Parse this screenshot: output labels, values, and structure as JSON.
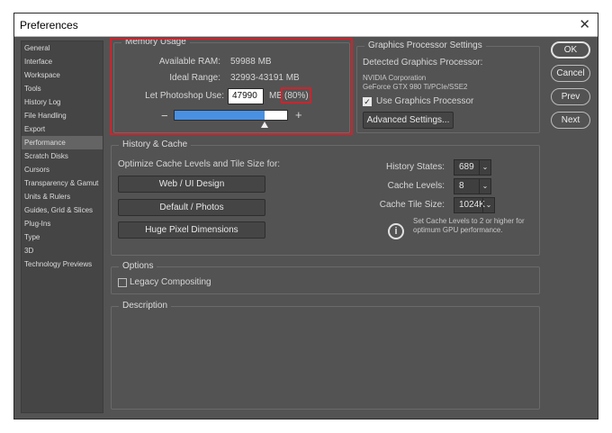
{
  "window": {
    "title": "Preferences",
    "close_glyph": "✕"
  },
  "sidebar": {
    "items": [
      {
        "label": "General"
      },
      {
        "label": "Interface"
      },
      {
        "label": "Workspace"
      },
      {
        "label": "Tools"
      },
      {
        "label": "History Log"
      },
      {
        "label": "File Handling"
      },
      {
        "label": "Export"
      },
      {
        "label": "Performance",
        "selected": true
      },
      {
        "label": "Scratch Disks"
      },
      {
        "label": "Cursors"
      },
      {
        "label": "Transparency & Gamut"
      },
      {
        "label": "Units & Rulers"
      },
      {
        "label": "Guides, Grid & Slices"
      },
      {
        "label": "Plug-Ins"
      },
      {
        "label": "Type"
      },
      {
        "label": "3D"
      },
      {
        "label": "Technology Previews"
      }
    ]
  },
  "memory": {
    "legend": "Memory Usage",
    "available_label": "Available RAM:",
    "available_value": "59988 MB",
    "ideal_label": "Ideal Range:",
    "ideal_value": "32993-43191 MB",
    "use_label": "Let Photoshop Use:",
    "use_value": "47990",
    "use_unit": "MB",
    "use_percent": "(80%)",
    "minus": "−",
    "plus": "+",
    "slider_fraction": 0.8,
    "highlight_color": "#d1222b"
  },
  "gpu": {
    "legend": "Graphics Processor Settings",
    "detected_label": "Detected Graphics Processor:",
    "vendor": "NVIDIA Corporation",
    "model": "GeForce GTX 980 Ti/PCIe/SSE2",
    "use_gpu_label": "Use Graphics Processor",
    "use_gpu_checked": true,
    "advanced_button": "Advanced Settings..."
  },
  "history_cache": {
    "legend": "History & Cache",
    "optimize_label": "Optimize Cache Levels and Tile Size for:",
    "buttons": [
      "Web / UI Design",
      "Default / Photos",
      "Huge Pixel Dimensions"
    ],
    "history_states_label": "History States:",
    "history_states_value": "689",
    "cache_levels_label": "Cache Levels:",
    "cache_levels_value": "8",
    "cache_tile_label": "Cache Tile Size:",
    "cache_tile_value": "1024K",
    "info_text_1": "Set Cache Levels to 2 or higher for",
    "info_text_2": "optimum GPU performance.",
    "info_icon": "i",
    "caret": "⌄"
  },
  "options": {
    "legend": "Options",
    "legacy_label": "Legacy Compositing",
    "legacy_checked": false
  },
  "description": {
    "legend": "Description"
  },
  "actions": {
    "ok": "OK",
    "cancel": "Cancel",
    "prev": "Prev",
    "next": "Next"
  },
  "colors": {
    "panel_bg": "#535353",
    "slider_fill": "#4a90e2",
    "accent_red": "#d1222b"
  }
}
